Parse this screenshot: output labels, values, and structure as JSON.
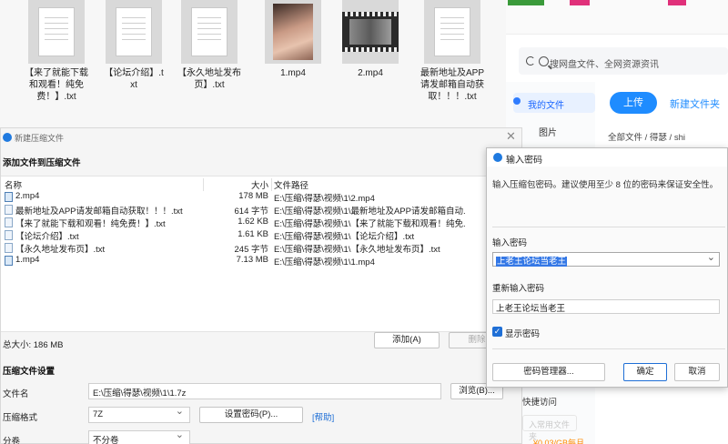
{
  "explorer": {
    "files": [
      {
        "name": "【来了就能下载和观看！纯免费！】.txt",
        "kind": "text"
      },
      {
        "name": "【论坛介绍】.txt",
        "kind": "text"
      },
      {
        "name": "【永久地址发布页】.txt",
        "kind": "text"
      },
      {
        "name": "1.mp4",
        "kind": "photo"
      },
      {
        "name": "2.mp4",
        "kind": "video"
      },
      {
        "name": "最新地址及APP请发邮箱自动获取！！！.txt",
        "kind": "text"
      }
    ]
  },
  "cloud": {
    "search_placeholder": "搜网盘文件、全网资源资讯",
    "my_files": "我的文件",
    "pictures": "图片",
    "upload": "上传",
    "new_folder": "新建文件夹",
    "path": "全部文件 / 得瑟 / shi",
    "quick_access": "快捷访问",
    "add_quick": "入常用文件夹",
    "promo": "¥0.03/GB每月"
  },
  "compress": {
    "title": "新建压缩文件",
    "add_section": "添加文件到压缩文件",
    "columns": {
      "name": "名称",
      "size": "大小",
      "path": "文件路径"
    },
    "files": [
      {
        "name": "2.mp4",
        "size": "178 MB",
        "path": "E:\\压缩\\得瑟\\视频\\1\\2.mp4",
        "icon": "video-file-icon"
      },
      {
        "name": "最新地址及APP请发邮箱自动获取！！！.txt",
        "size": "614 字节",
        "path": "E:\\压缩\\得瑟\\视频\\1\\最新地址及APP请发邮箱自动...",
        "icon": "text-file-icon"
      },
      {
        "name": "【来了就能下载和观看！纯免费！】.txt",
        "size": "1.62 KB",
        "path": "E:\\压缩\\得瑟\\视频\\1\\【来了就能下载和观看！纯免...",
        "icon": "text-file-icon"
      },
      {
        "name": "【论坛介绍】.txt",
        "size": "1.61 KB",
        "path": "E:\\压缩\\得瑟\\视频\\1\\【论坛介绍】.txt",
        "icon": "text-file-icon"
      },
      {
        "name": "【永久地址发布页】.txt",
        "size": "245 字节",
        "path": "E:\\压缩\\得瑟\\视频\\1\\【永久地址发布页】.txt",
        "icon": "text-file-icon"
      },
      {
        "name": "1.mp4",
        "size": "7.13 MB",
        "path": "E:\\压缩\\得瑟\\视频\\1\\1.mp4",
        "icon": "video-file-icon"
      }
    ],
    "total": "总大小: 186 MB",
    "add_button": "添加(A)",
    "delete_button": "删除",
    "settings_section": "压缩文件设置",
    "filename_label": "文件名",
    "filename_value": "E:\\压缩\\得瑟\\视频\\1\\1.7z",
    "browse_button": "浏览(B)...",
    "format_label": "压缩格式",
    "format_value": "7Z",
    "set_password_button": "设置密码(P)...",
    "help_link": "[帮助]",
    "split_label": "分卷",
    "split_value": "不分卷"
  },
  "password": {
    "title": "输入密码",
    "hint": "输入压缩包密码。建议使用至少 8 位的密码来保证安全性。",
    "enter_label": "输入密码",
    "enter_value": "上老王论坛当老王",
    "reenter_label": "重新输入密码",
    "reenter_value": "上老王论坛当老王",
    "show_password": "显示密码",
    "manager_button": "密码管理器...",
    "ok_button": "确定",
    "cancel_button": "取消"
  }
}
